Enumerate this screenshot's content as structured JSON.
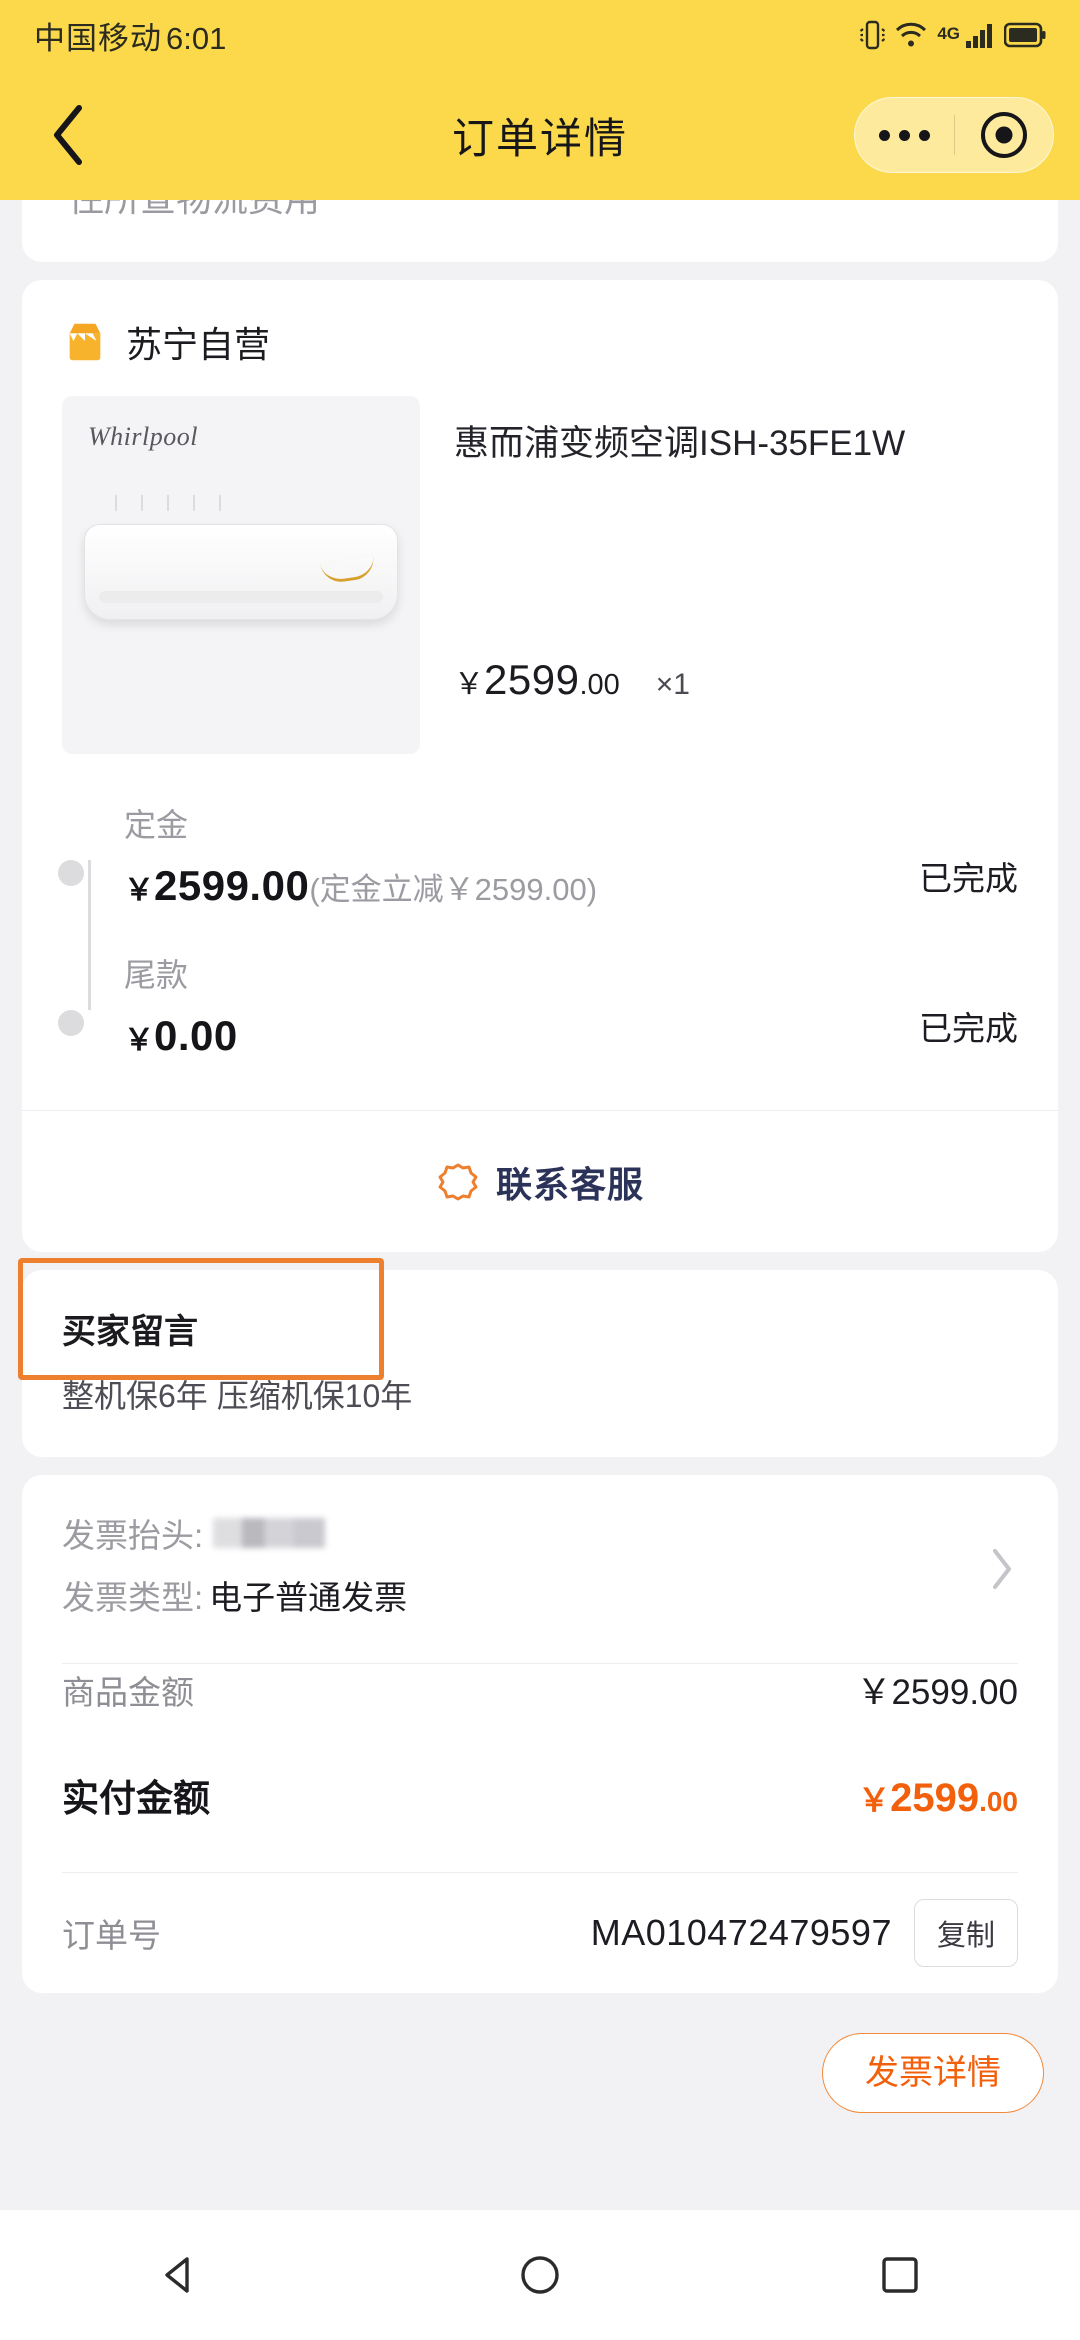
{
  "status_bar": {
    "carrier": "中国移动",
    "time": "6:01",
    "network": "4G",
    "icons": [
      "vibrate-icon",
      "wifi-icon",
      "signal-icon",
      "battery-icon"
    ]
  },
  "nav": {
    "title": "订单详情",
    "back_icon": "chevron-left-icon",
    "more_icon": "more-dots-icon",
    "target_icon": "target-circle-icon"
  },
  "partial_card": {
    "text": "住所查物流费用"
  },
  "merchant": {
    "name": "苏宁自营",
    "icon": "shop-icon"
  },
  "product": {
    "brand_mark": "Whirlpool",
    "title": "惠而浦变频空调ISH-35FE1W",
    "currency": "￥",
    "price_int": "2599",
    "price_dec": ".00",
    "quantity": "×1"
  },
  "payments": [
    {
      "label": "定金",
      "currency": "￥",
      "amount": "2599.00",
      "note": "(定金立减￥2599.00)",
      "status": "已完成"
    },
    {
      "label": "尾款",
      "currency": "￥",
      "amount": "0.00",
      "note": "",
      "status": "已完成"
    }
  ],
  "service": {
    "label": "联系客服",
    "icon": "customer-service-flower-icon"
  },
  "buyer_message": {
    "title": "买家留言",
    "text": "整机保6年 压缩机保10年",
    "highlight_color": "#ee7f2e"
  },
  "invoice": {
    "title_key": "发票抬头:",
    "title_value": "",
    "type_key": "发票类型:",
    "type_value": "电子普通发票",
    "chevron_icon": "chevron-right-icon"
  },
  "totals": {
    "goods_key": "商品金额",
    "goods_value": "￥2599.00",
    "paid_key": "实付金额",
    "paid_currency": "￥",
    "paid_int": "2599",
    "paid_dec": ".00",
    "order_key": "订单号",
    "order_value": "MA010472479597",
    "copy_label": "复制"
  },
  "footer": {
    "invoice_detail_label": "发票详情"
  },
  "android_nav": {
    "back_icon": "triangle-back-icon",
    "home_icon": "circle-home-icon",
    "recents_icon": "square-recents-icon"
  },
  "colors": {
    "header": "#fcd94b",
    "accent_orange": "#f2600c",
    "page_bg": "#f2f2f4"
  }
}
